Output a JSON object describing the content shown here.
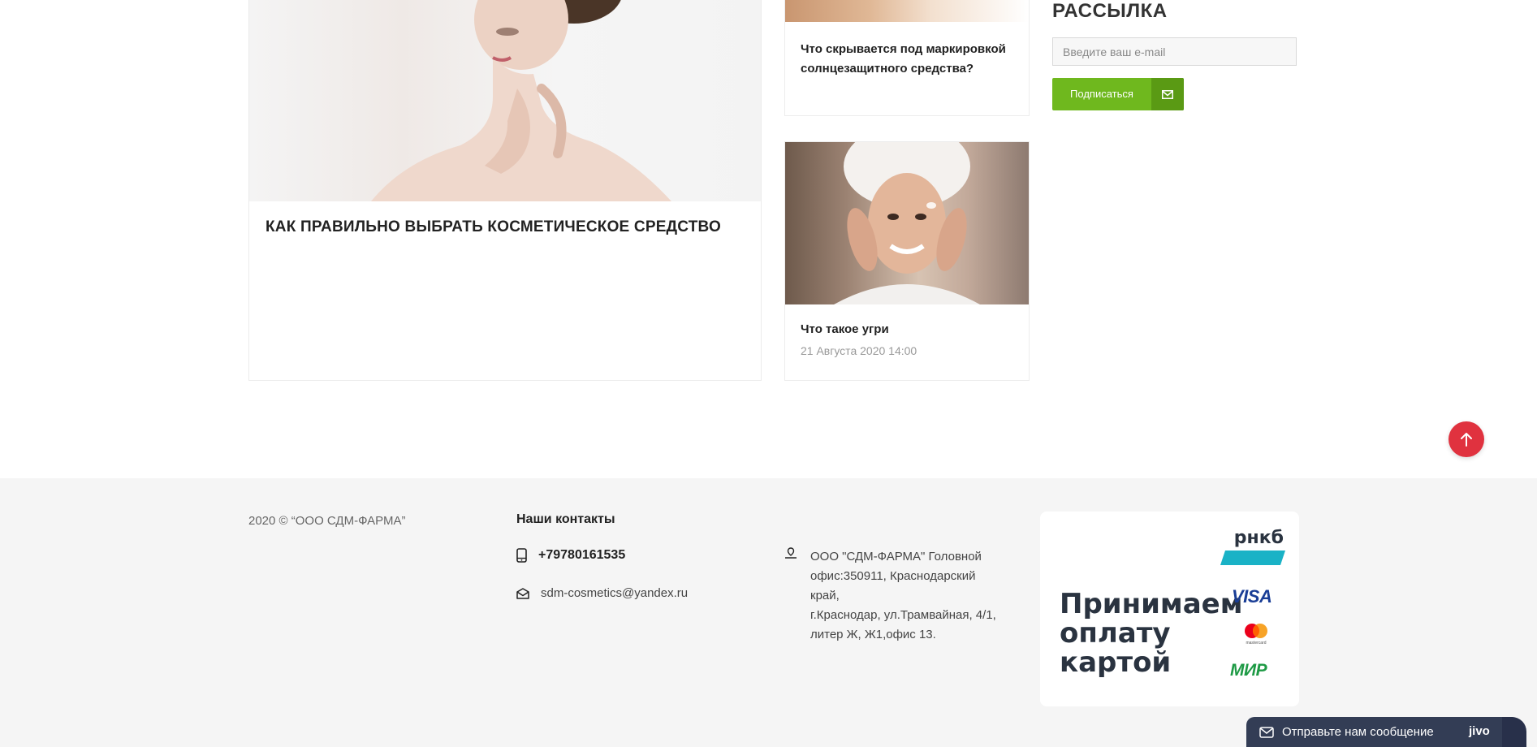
{
  "articles": {
    "main": {
      "title": "КАК ПРАВИЛЬНО ВЫБРАТЬ КОСМЕТИЧЕСКОЕ СРЕДСТВО"
    },
    "side": [
      {
        "title": "Что скрывается под маркировкой солнцезащитного средства?"
      },
      {
        "title": "Что такое угри",
        "date": "21 Августа 2020 14:00"
      }
    ]
  },
  "newsletter": {
    "heading": "РАССЫЛКА",
    "placeholder": "Введите ваш e-mail",
    "button_label": "Подписаться",
    "button_icon": "envelope-icon"
  },
  "scroll_top": {
    "icon": "arrow-up-icon",
    "color": "#e0323f"
  },
  "footer": {
    "copyright": "2020 © “ООО СДМ-ФАРМА”",
    "contacts_heading": "Наши контакты",
    "phone": "+79780161535",
    "email": "sdm-cosmetics@yandex.ru",
    "address_lines": [
      "ООО \"СДМ-ФАРМА\" Головной",
      "офис:350911, Краснодарский",
      "край,",
      "г.Краснодар, ул.Трамвайная, 4/1,",
      "литер Ж, Ж1,офис 13."
    ],
    "payment": {
      "text_lines": [
        "Принимаем",
        "оплату",
        "картой"
      ],
      "logos": {
        "rnkb": "рнкб",
        "visa": "VISA",
        "mir": "МИР",
        "mastercard_caption": "mastercard"
      }
    }
  },
  "chat": {
    "label": "Отправьте нам сообщение",
    "brand": "jivo"
  },
  "colors": {
    "accent_green": "#6fb81e",
    "accent_green_dark": "#5a9a14",
    "footer_bg": "#f5f5f5",
    "chat_bg": "#333d55"
  }
}
